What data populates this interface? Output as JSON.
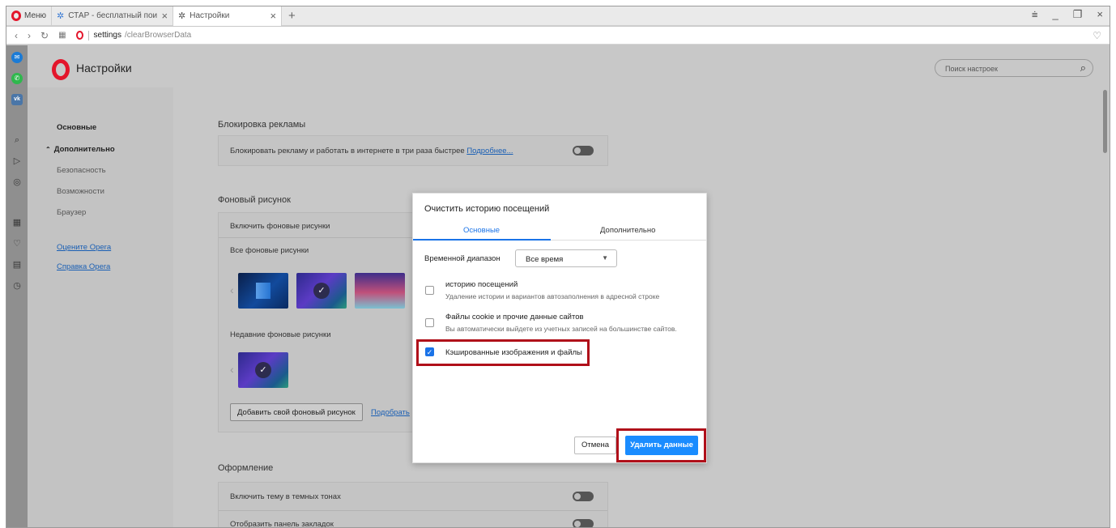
{
  "tabbar": {
    "menu_label": "Меню",
    "tabs": [
      {
        "title": "СТАР - бесплатный поиск",
        "active": false
      },
      {
        "title": "Настройки",
        "active": true
      }
    ]
  },
  "address": {
    "host": "settings",
    "path": "/clearBrowserData"
  },
  "settings": {
    "title": "Настройки",
    "search_placeholder": "Поиск настроек",
    "nav": {
      "basic": "Основные",
      "advanced": "Дополнительно",
      "security": "Безопасность",
      "features": "Возможности",
      "browser": "Браузер",
      "rate": "Оцените Opera",
      "help": "Справка Opera"
    },
    "adblock": {
      "title": "Блокировка рекламы",
      "text": "Блокировать рекламу и работать в интернете в три раза быстрее",
      "link": "Подробнее..."
    },
    "wallpaper": {
      "title": "Фоновый рисунок",
      "enable": "Включить фоновые рисунки",
      "all": "Все фоновые рисунки",
      "recent": "Недавние фоновые рисунки",
      "add_button": "Добавить свой фоновый рисунок",
      "pick_link": "Подобрать"
    },
    "appearance": {
      "title": "Оформление",
      "dark": "Включить тему в темных тонах",
      "bookmarks": "Отобразить панель закладок"
    }
  },
  "modal": {
    "title": "Очистить историю посещений",
    "tab_basic": "Основные",
    "tab_advanced": "Дополнительно",
    "time_label": "Временной диапазон",
    "time_value": "Все время",
    "options": [
      {
        "title": "историю посещений",
        "desc": "Удаление истории и вариантов автозаполнения в адресной строке",
        "checked": false
      },
      {
        "title": "Файлы cookie и прочие данные сайтов",
        "desc": "Вы автоматически выйдете из учетных записей на большинстве сайтов.",
        "checked": false
      },
      {
        "title": "Кэшированные изображения и файлы",
        "desc": "",
        "checked": true
      }
    ],
    "cancel": "Отмена",
    "delete": "Удалить данные"
  },
  "colors": {
    "accent": "#1a73e8",
    "highlight": "#b0101a",
    "opera_red": "#e3152b"
  }
}
